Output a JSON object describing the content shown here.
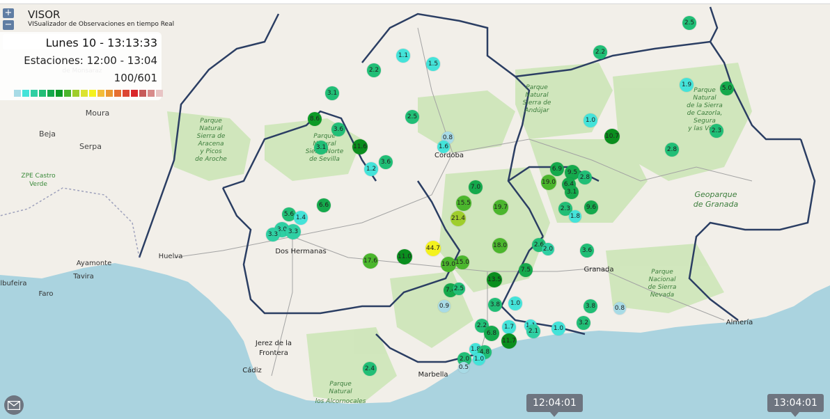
{
  "app": {
    "title": "VISOR",
    "subtitle": "VISualizador de Observaciones en tiempo Real"
  },
  "controls": {
    "zoom_in": "+",
    "zoom_out": "−"
  },
  "panel": {
    "date_time": "Lunes 10 - 13:13:33",
    "station_range": "Estaciones: 12:00 - 13:04",
    "station_count": "100/601"
  },
  "legend_colors": [
    "#a8dbe6",
    "#44e3d9",
    "#2fcfa3",
    "#21be76",
    "#15a94c",
    "#0c9a26",
    "#4bb62d",
    "#9fce2b",
    "#dbe330",
    "#f4f21d",
    "#f3bd3a",
    "#eb9832",
    "#e67031",
    "#dc4633",
    "#d9262a",
    "#c75a5a",
    "#d88b8b",
    "#e8c4c4"
  ],
  "map_labels": {
    "places": [
      "de Monsaraz",
      "Moura",
      "Beja",
      "Serpa",
      "ZPE Castro",
      "Verde",
      "Ayamonte",
      "Huelva",
      "Tavira",
      "Faro",
      "Albufeira",
      "Dos Hermanas",
      "Córdoba",
      "Granada",
      "Almería",
      "Jerez de la",
      "Frontera",
      "Marbella",
      "Cádiz"
    ],
    "parks": [
      "Parque",
      "Natural",
      "Sierra de",
      "Aracena",
      "y Picos",
      "de Aroche",
      "Parque",
      "Natural",
      "Sierra Norte",
      "de Sevilla",
      "Parque",
      "Natural",
      "Sierra de",
      "Andújar",
      "Parque",
      "Natural",
      "de la Sierra",
      "de Cazorla,",
      "Segura",
      "y las Villas",
      "Geoparque",
      "de Granada",
      "Parque",
      "Nacional",
      "de Sierra",
      "Nevada",
      "Parque",
      "Natural",
      "los Alcornocales"
    ]
  },
  "stations": [
    {
      "value": "2.5",
      "color": "#21be76"
    },
    {
      "value": "2.2",
      "color": "#21be76"
    },
    {
      "value": "1.1",
      "color": "#44e3d9"
    },
    {
      "value": "1.5",
      "color": "#44e3d9"
    },
    {
      "value": "2.2",
      "color": "#21be76"
    },
    {
      "value": "1.9",
      "color": "#44e3d9"
    },
    {
      "value": "5.0",
      "color": "#15a94c"
    },
    {
      "value": "3.1",
      "color": "#21be76"
    },
    {
      "value": "2.5",
      "color": "#21be76"
    },
    {
      "value": "1.0",
      "color": "#44e3d9"
    },
    {
      "value": "8.6",
      "color": "#0c9a26"
    },
    {
      "value": "3.6",
      "color": "#21be76"
    },
    {
      "value": "3.1",
      "color": "#21be76"
    },
    {
      "value": "11.6",
      "color": "#0a8e1e"
    },
    {
      "value": "0.8",
      "color": "#a8dbe6"
    },
    {
      "value": "1.6",
      "color": "#44e3d9"
    },
    {
      "value": "10.7",
      "color": "#0a8e1e"
    },
    {
      "value": "2.3",
      "color": "#21be76"
    },
    {
      "value": "2.8",
      "color": "#21be76"
    },
    {
      "value": "1.2",
      "color": "#44e3d9"
    },
    {
      "value": "3.6",
      "color": "#21be76"
    },
    {
      "value": "6.9",
      "color": "#15a94c"
    },
    {
      "value": "9.5",
      "color": "#15a94c"
    },
    {
      "value": "19.0",
      "color": "#4bb62d"
    },
    {
      "value": "6.4",
      "color": "#15a94c"
    },
    {
      "value": "2.8",
      "color": "#21be76"
    },
    {
      "value": "3.1",
      "color": "#15a94c"
    },
    {
      "value": "7.0",
      "color": "#15a94c"
    },
    {
      "value": "15.5",
      "color": "#4bb62d"
    },
    {
      "value": "19.7",
      "color": "#4bb62d"
    },
    {
      "value": "9.6",
      "color": "#15a94c"
    },
    {
      "value": "2.3",
      "color": "#21be76"
    },
    {
      "value": "6.6",
      "color": "#15a94c"
    },
    {
      "value": "5.6",
      "color": "#21be76"
    },
    {
      "value": "1.4",
      "color": "#44e3d9"
    },
    {
      "value": "1.8",
      "color": "#44e3d9"
    },
    {
      "value": "21.4",
      "color": "#9fce2b"
    },
    {
      "value": "3.0",
      "color": "#2fcfa3"
    },
    {
      "value": "3.3",
      "color": "#2fcfa3"
    },
    {
      "value": "3.3",
      "color": "#2fcfa3"
    },
    {
      "value": "2.6",
      "color": "#21be76"
    },
    {
      "value": "2.0",
      "color": "#2fcfa3"
    },
    {
      "value": "18.0",
      "color": "#4bb62d"
    },
    {
      "value": "44.7",
      "color": "#f4f21d"
    },
    {
      "value": "3.6",
      "color": "#21be76"
    },
    {
      "value": "17.6",
      "color": "#4bb62d"
    },
    {
      "value": "11.0",
      "color": "#0a8e1e"
    },
    {
      "value": "19.0",
      "color": "#4bb62d"
    },
    {
      "value": "15.0",
      "color": "#4bb62d"
    },
    {
      "value": "7.5",
      "color": "#15a94c"
    },
    {
      "value": "13.5",
      "color": "#0a8e1e"
    },
    {
      "value": "7.4",
      "color": "#15a94c"
    },
    {
      "value": "2.5",
      "color": "#21be76"
    },
    {
      "value": "0.9",
      "color": "#a8dbe6"
    },
    {
      "value": "3.8",
      "color": "#21be76"
    },
    {
      "value": "1.0",
      "color": "#44e3d9"
    },
    {
      "value": "3.8",
      "color": "#21be76"
    },
    {
      "value": "0.8",
      "color": "#a8dbe6"
    },
    {
      "value": "2.2",
      "color": "#21be76"
    },
    {
      "value": "1.7",
      "color": "#44e3d9"
    },
    {
      "value": "1.1",
      "color": "#44e3d9"
    },
    {
      "value": "1.0",
      "color": "#44e3d9"
    },
    {
      "value": "3.2",
      "color": "#21be76"
    },
    {
      "value": "6.8",
      "color": "#15a94c"
    },
    {
      "value": "2.1",
      "color": "#2fcfa3"
    },
    {
      "value": "11.7",
      "color": "#0a8e1e"
    },
    {
      "value": "1.8",
      "color": "#44e3d9"
    },
    {
      "value": "4.8",
      "color": "#21be76"
    },
    {
      "value": "2.0",
      "color": "#21be76"
    },
    {
      "value": "1.0",
      "color": "#44e3d9"
    },
    {
      "value": "0.5",
      "color": "#a8dbe6"
    },
    {
      "value": "2.4",
      "color": "#21be76"
    }
  ],
  "timeline": {
    "start": "12:04:01",
    "end": "13:04:01"
  },
  "icons": {
    "mail": "envelope-icon"
  },
  "colors": {
    "sea": "#aad3df",
    "land": "#f2efe9",
    "forest": "#cde6b8",
    "border": "#2b3e63"
  }
}
